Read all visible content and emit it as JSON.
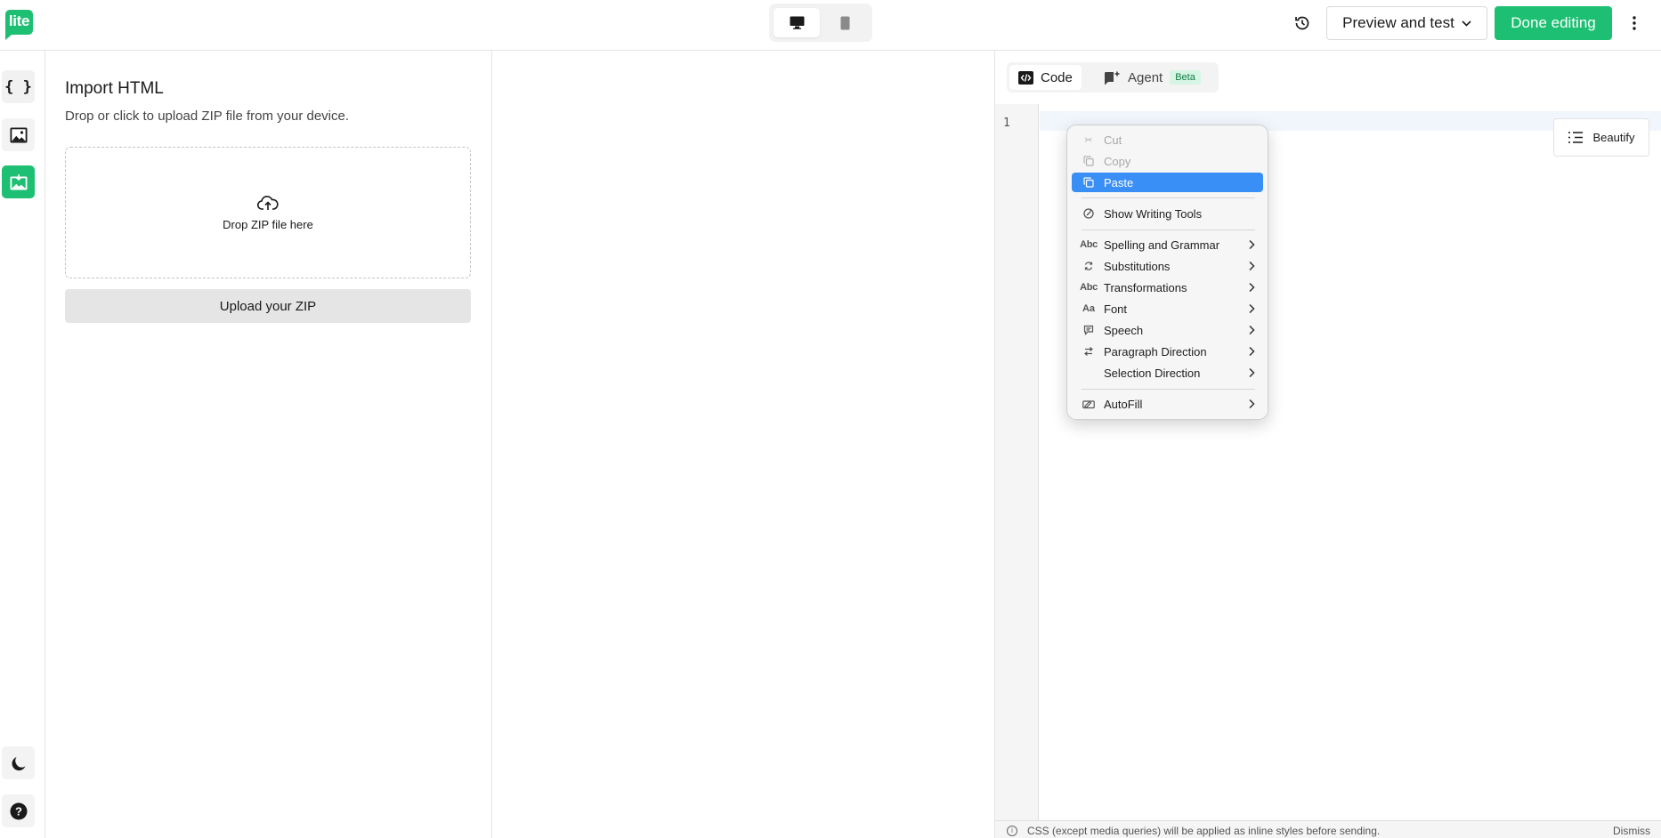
{
  "app": {
    "logo_text": "lite"
  },
  "topbar": {
    "device_desktop_icon": "desktop-icon",
    "device_mobile_icon": "mobile-icon",
    "history_icon": "history-icon",
    "preview_label": "Preview and test",
    "done_label": "Done editing",
    "more_icon": "more-vertical-icon"
  },
  "rail": {
    "items": [
      {
        "icon": "code-braces-icon",
        "active": false
      },
      {
        "icon": "image-icon",
        "active": false
      },
      {
        "icon": "import-image-icon",
        "active": true
      }
    ],
    "bottom": [
      {
        "icon": "moon-icon"
      },
      {
        "icon": "help-icon"
      }
    ]
  },
  "import_panel": {
    "title": "Import HTML",
    "description": "Drop or click to upload ZIP file from your device.",
    "dropzone_text": "Drop ZIP file here",
    "upload_button": "Upload your ZIP"
  },
  "editor": {
    "tabs": [
      {
        "label": "Code",
        "icon": "code-icon",
        "active": true
      },
      {
        "label": "Agent",
        "icon": "agent-icon",
        "badge": "Beta",
        "active": false
      }
    ],
    "line_numbers": [
      "1"
    ],
    "beautify_label": "Beautify",
    "notice_text": "CSS (except media queries) will be applied as inline styles before sending.",
    "dismiss_label": "Dismiss"
  },
  "context_menu": {
    "items": [
      {
        "label": "Cut",
        "icon": "scissors-icon",
        "disabled": true
      },
      {
        "label": "Copy",
        "icon": "copy-icon",
        "disabled": true
      },
      {
        "label": "Paste",
        "icon": "paste-icon",
        "highlighted": true
      },
      {
        "label": "Show Writing Tools",
        "icon": "writing-tools-icon"
      },
      {
        "label": "Spelling and Grammar",
        "icon": "abc-icon",
        "submenu": true
      },
      {
        "label": "Substitutions",
        "icon": "substitutions-icon",
        "submenu": true
      },
      {
        "label": "Transformations",
        "icon": "abc-icon",
        "submenu": true
      },
      {
        "label": "Font",
        "icon": "font-icon",
        "submenu": true
      },
      {
        "label": "Speech",
        "icon": "speech-icon",
        "submenu": true
      },
      {
        "label": "Paragraph Direction",
        "icon": "paragraph-direction-icon",
        "submenu": true
      },
      {
        "label": "Selection Direction",
        "submenu": true
      },
      {
        "label": "AutoFill",
        "icon": "autofill-icon",
        "submenu": true
      }
    ]
  },
  "colors": {
    "brand_green": "#1dbf73",
    "menu_highlight": "#3a8ff7"
  }
}
